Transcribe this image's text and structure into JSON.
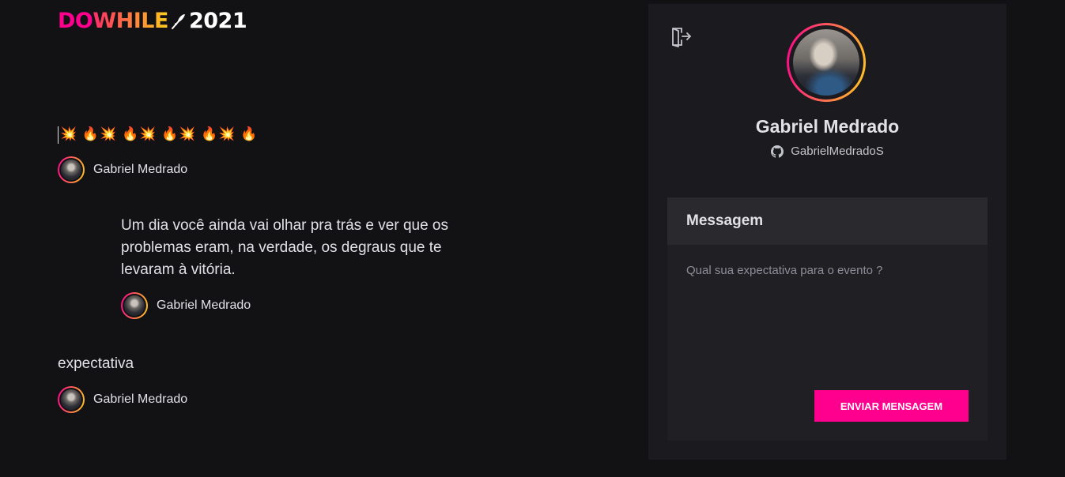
{
  "logo": {
    "do": "DO",
    "while": "WHILE",
    "year": "2021"
  },
  "messages": [
    {
      "text": "💥 🔥💥 🔥💥 🔥💥 🔥💥 🔥",
      "user": "Gabriel Medrado"
    },
    {
      "text": "Um dia você ainda vai olhar pra trás e ver que os problemas eram, na verdade, os degraus que te levaram à vitória.",
      "user": "Gabriel Medrado"
    },
    {
      "text": "expectativa",
      "user": "Gabriel Medrado"
    }
  ],
  "profile": {
    "name": "Gabriel Medrado",
    "github": "GabrielMedradoS"
  },
  "form": {
    "title": "Messagem",
    "placeholder": "Qual sua expectativa para o evento ?",
    "submit_label": "ENVIAR MENSAGEM"
  },
  "colors": {
    "background": "#121214",
    "sidebar": "#1b1b1f",
    "accent_pink": "#ff008e",
    "accent_yellow": "#ffcd1e"
  }
}
